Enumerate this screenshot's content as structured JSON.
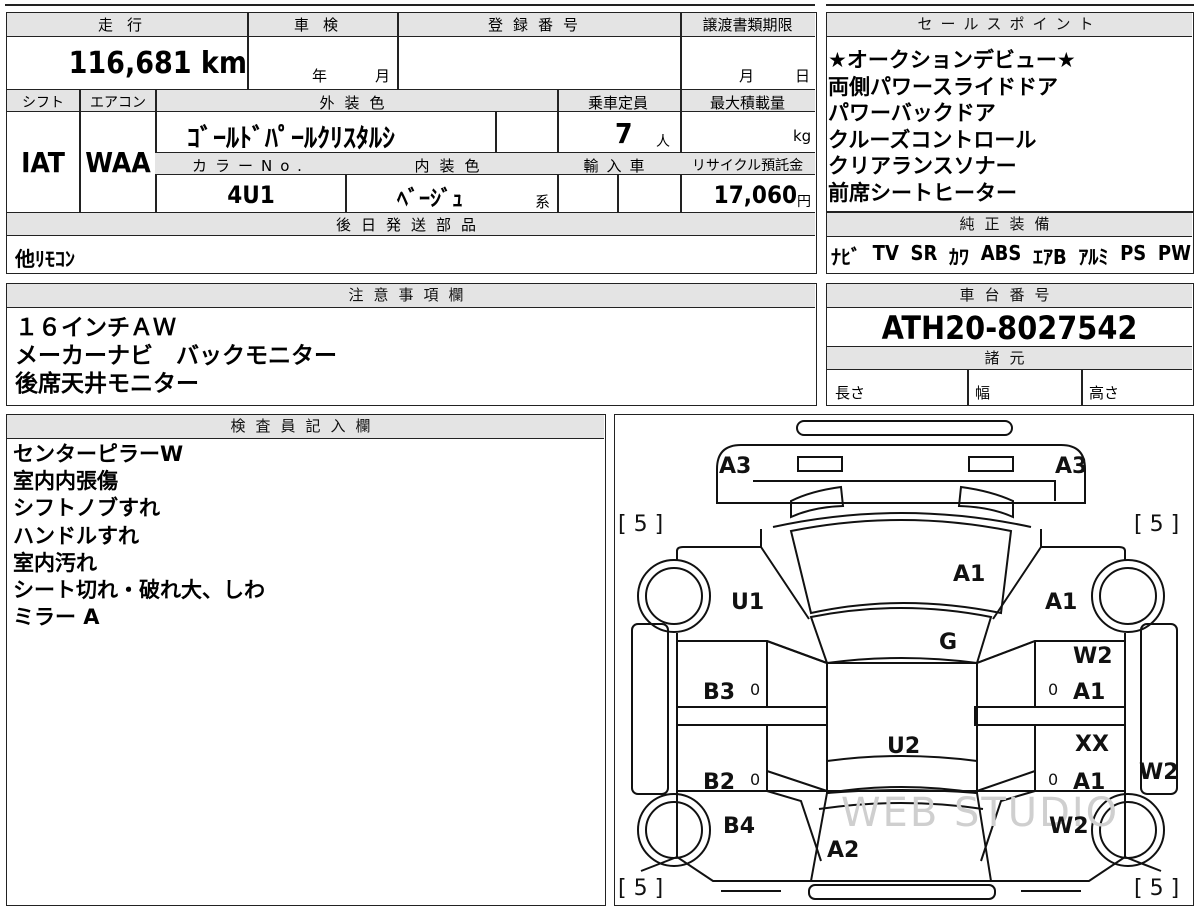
{
  "vehicle": {
    "mileage_label": "走行",
    "mileage": "116,681 km",
    "inspection_label": "車検",
    "inspection_year_unit": "年",
    "inspection_month_unit": "月",
    "registration_label": "登録番号",
    "transfer_deadline_label": "譲渡書類期限",
    "transfer_month_unit": "月",
    "transfer_day_unit": "日",
    "shift_label": "シフト",
    "shift": "IAT",
    "aircon_label": "エアコン",
    "aircon": "WAA",
    "exterior_color_label": "外装色",
    "exterior_color": "ｺﾞｰﾙﾄﾞﾊﾟｰﾙｸﾘｽﾀﾙｼ",
    "capacity_label": "乗車定員",
    "capacity": "7",
    "capacity_unit": "人",
    "max_load_label": "最大積載量",
    "max_load_unit": "kg",
    "color_no_label": "カラーNo.",
    "color_no": "4U1",
    "interior_color_label": "内装色",
    "interior_color": "ﾍﾞｰｼﾞｭ",
    "interior_color_suffix": "系",
    "import_label": "輸入車",
    "recycle_label": "リサイクル預託金",
    "recycle_fee": "17,060",
    "recycle_unit": "円",
    "later_parts_label": "後日発送部品",
    "later_parts": "他ﾘﾓｺﾝ"
  },
  "sales_points": {
    "label": "セールスポイント",
    "items": [
      "★オークションデビュー★",
      "両側パワースライドドア",
      "パワーバックドア",
      "クルーズコントロール",
      "クリアランスソナー",
      "前席シートヒーター"
    ]
  },
  "genuine_equipment": {
    "label": "純正装備",
    "items": [
      "ﾅﾋﾞ",
      "TV",
      "SR",
      "ｶﾜ",
      "ABS",
      "ｴｱB",
      "ｱﾙﾐ",
      "PS",
      "PW"
    ]
  },
  "notes": {
    "label": "注意事項欄",
    "items": [
      "１６インチＡＷ",
      "メーカーナビ　バックモニター",
      "後席天井モニター"
    ]
  },
  "chassis": {
    "label": "車台番号",
    "number": "ATH20-8027542",
    "specs_label": "諸元",
    "length_label": "長さ",
    "width_label": "幅",
    "height_label": "高さ"
  },
  "inspector": {
    "label": "検査員記入欄",
    "items": [
      "センターピラーW",
      "室内内張傷",
      "シフトノブすれ",
      "ハンドルすれ",
      "室内汚れ",
      "シート切れ・破れ大、しわ",
      "ミラー A"
    ]
  },
  "diagram": {
    "marks": {
      "a3_left": "A3",
      "a3_right": "A3",
      "tire_fl": "[ 5 ]",
      "tire_fr": "[ 5 ]",
      "tire_rl": "[ 5 ]",
      "tire_rr": "[ 5 ]",
      "a1_hood": "A1",
      "u1_left": "U1",
      "a1_right_fender": "A1",
      "g_windshield": "G",
      "w2_front_right": "W2",
      "b3_left": "B3",
      "zero_b3": "0",
      "zero_a1_right": "0",
      "a1_right_front_door": "A1",
      "u2_roof": "U2",
      "xx_right": "XX",
      "b2_left": "B2",
      "zero_b2": "0",
      "zero_a1_right_rear": "0",
      "a1_right_rear_door": "A1",
      "w2_right_side": "W2",
      "b4_left": "B4",
      "w2_rear_right": "W2",
      "a2_rear": "A2"
    },
    "watermark": "WEB STUDIO"
  }
}
